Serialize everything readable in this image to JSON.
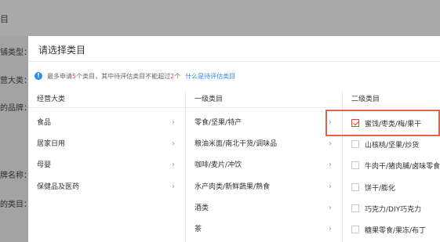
{
  "background": {
    "topbar_title": "目",
    "labels": [
      {
        "text": "铺类型："
      },
      {
        "text": "营大类："
      },
      {
        "text": "的品牌："
      },
      {
        "text": "牌名称："
      },
      {
        "text": "的类目："
      }
    ]
  },
  "modal": {
    "title": "请选择类目",
    "notice": {
      "prefix": "最多申请",
      "count": "5",
      "middle": "个类目，其中待评估类目不能超过",
      "limit": "2",
      "suffix": "个",
      "link": "什么是待评估类目"
    },
    "columns": {
      "col1": "经营大类",
      "col2": "一级类目",
      "col3": "二级类目"
    },
    "col1_items": [
      {
        "label": "食品",
        "arrow": "›"
      },
      {
        "label": "居家日用",
        "arrow": "›"
      },
      {
        "label": "母婴",
        "arrow": "›"
      },
      {
        "label": "保健品及医药",
        "arrow": "›"
      }
    ],
    "col2_items": [
      {
        "label": "零食/坚果/特产",
        "arrow": "›"
      },
      {
        "label": "粮油米面/南北干货/调味品",
        "arrow": "›"
      },
      {
        "label": "咖啡/麦片/冲饮",
        "arrow": "›"
      },
      {
        "label": "水产肉类/新鲜蔬果/熟食",
        "arrow": "›"
      },
      {
        "label": "酒类",
        "arrow": "›"
      },
      {
        "label": "茶",
        "arrow": "›"
      }
    ],
    "col3_items": [
      {
        "label": "蜜饯/枣类/梅/果干",
        "checked": true
      },
      {
        "label": "山核桃/坚果/炒货",
        "checked": false
      },
      {
        "label": "牛肉干/猪肉脯/卤味零食",
        "checked": false
      },
      {
        "label": "饼干/膨化",
        "checked": false
      },
      {
        "label": "巧克力/DIY巧克力",
        "checked": false
      },
      {
        "label": "糖果零食/果冻/布丁",
        "checked": false
      }
    ],
    "highlight_color": "#e8604c"
  }
}
